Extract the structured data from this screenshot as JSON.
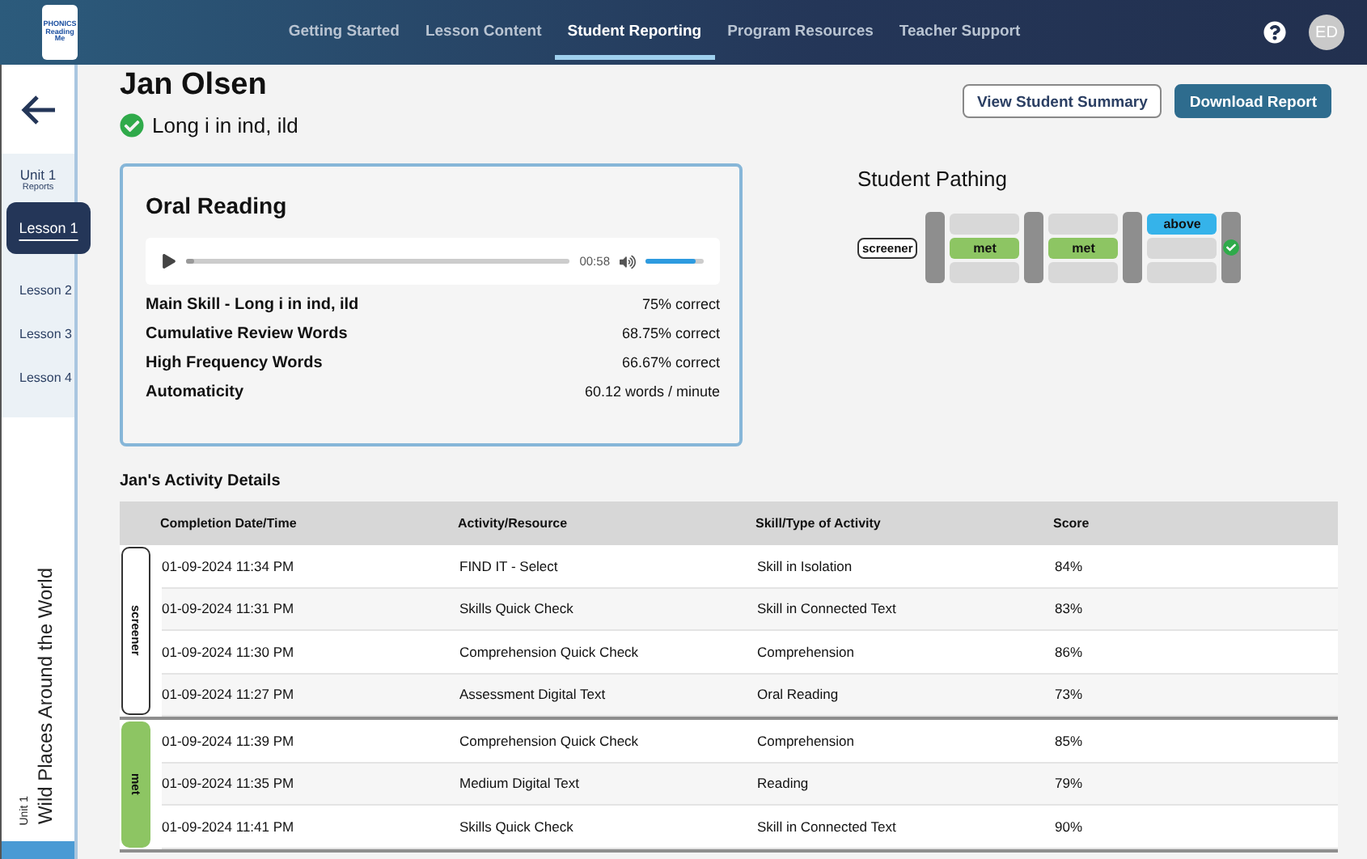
{
  "header": {
    "logo": [
      "PHONICS",
      "Reading",
      "Me"
    ],
    "nav": [
      {
        "label": "Getting Started",
        "selected": false
      },
      {
        "label": "Lesson Content",
        "selected": false
      },
      {
        "label": "Student Reporting",
        "selected": true
      },
      {
        "label": "Program Resources",
        "selected": false
      },
      {
        "label": "Teacher Support",
        "selected": false
      }
    ],
    "avatar": "ED"
  },
  "sidebar": {
    "unit": "Unit 1",
    "subtitle": "Reports",
    "lessons": [
      {
        "label": "Lesson 1",
        "selected": true
      },
      {
        "label": "Lesson 2",
        "selected": false
      },
      {
        "label": "Lesson 3",
        "selected": false
      },
      {
        "label": "Lesson 4",
        "selected": false
      }
    ],
    "unit_caption": "Unit 1",
    "unit_title": "Wild Places Around the World"
  },
  "student": {
    "name": "Jan Olsen",
    "skill": "Long i in ind, ild",
    "completed": true
  },
  "actions": [
    {
      "label": "View Student Summary",
      "kind": "outline"
    },
    {
      "label": "Download Report",
      "kind": "primary"
    }
  ],
  "oral_reading": {
    "title": "Oral Reading",
    "player": {
      "progress": {
        "level": 0.02
      },
      "time": "00:58",
      "volume": {
        "level": 0.85
      }
    },
    "metrics": [
      {
        "label": "Main Skill - Long i in ind, ild",
        "value": "75% correct"
      },
      {
        "label": "Cumulative Review Words",
        "value": "68.75% correct"
      },
      {
        "label": "High Frequency Words",
        "value": "66.67% correct"
      },
      {
        "label": "Automaticity",
        "value": "60.12 words / minute"
      }
    ]
  },
  "pathing": {
    "title": "Student Pathing",
    "start": "screener",
    "steps": [
      {
        "kind": "met",
        "label": "met"
      },
      {
        "kind": "met",
        "label": "met"
      },
      {
        "kind": "above",
        "label": "above"
      }
    ],
    "completed": true
  },
  "activity": {
    "title": "Jan's Activity Details",
    "columns": [
      "Completion Date/Time",
      "Activity/Resource",
      "Skill/Type of Activity",
      "Score"
    ],
    "groups": [
      {
        "label": "screener",
        "kind": "screener",
        "rows": [
          [
            "01-09-2024 11:34 PM",
            "FIND IT - Select",
            "Skill in Isolation",
            "84%"
          ],
          [
            "01-09-2024 11:31 PM",
            "Skills Quick Check",
            "Skill in Connected Text",
            "83%"
          ],
          [
            "01-09-2024 11:30 PM",
            "Comprehension Quick Check",
            "Comprehension",
            "86%"
          ],
          [
            "01-09-2024 11:27 PM",
            "Assessment Digital Text",
            "Oral Reading",
            "73%"
          ]
        ]
      },
      {
        "label": "met",
        "kind": "met",
        "rows": [
          [
            "01-09-2024 11:39 PM",
            "Comprehension Quick Check",
            "Comprehension",
            "85%"
          ],
          [
            "01-09-2024 11:35 PM",
            "Medium Digital Text",
            "Reading",
            "79%"
          ],
          [
            "01-09-2024 11:41 PM",
            "Skills Quick Check",
            "Skill in Connected Text",
            "90%"
          ]
        ]
      }
    ]
  }
}
